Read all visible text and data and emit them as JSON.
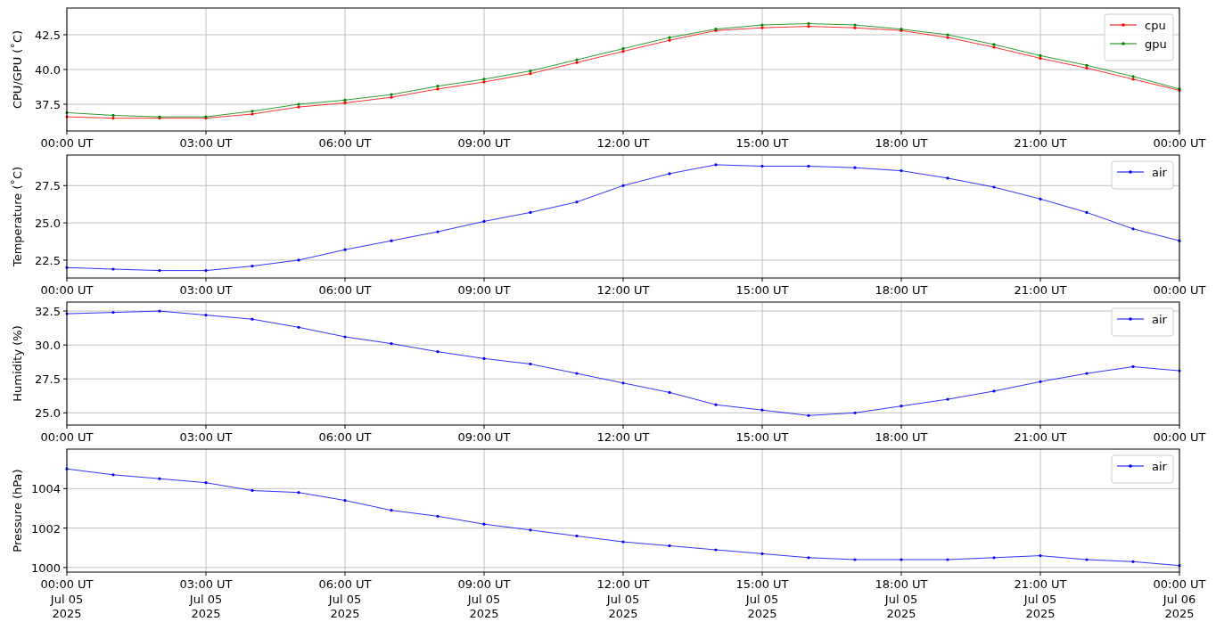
{
  "charts": [
    {
      "chart_data": {
        "type": "line",
        "grid": true,
        "legend": true,
        "ylabel": "CPU/GPU (˚C)",
        "categories": [
          "00:00 UT",
          null,
          null,
          "03:00 UT",
          null,
          null,
          "06:00 UT",
          null,
          null,
          "09:00 UT",
          null,
          null,
          "12:00 UT",
          null,
          null,
          "15:00 UT",
          null,
          null,
          "18:00 UT",
          null,
          null,
          "21:00 UT",
          null,
          null,
          "00:00 UT"
        ],
        "ylim": [
          35.58,
          44.42
        ],
        "yticks": [
          {
            "value": 37.5,
            "label": "37.5"
          },
          {
            "value": 40,
            "label": "40.0"
          },
          {
            "value": 42.5,
            "label": "42.5"
          }
        ],
        "series": [
          {
            "name": "cpu",
            "color": "#ff0000",
            "values": [
              36.6,
              36.5,
              36.5,
              36.5,
              36.8,
              37.3,
              37.6,
              38.0,
              38.6,
              39.1,
              39.7,
              40.5,
              41.3,
              42.1,
              42.8,
              43.0,
              43.1,
              43.0,
              42.8,
              42.3,
              41.6,
              40.8,
              40.1,
              39.3,
              38.5
            ]
          },
          {
            "name": "gpu",
            "color": "#008000",
            "values": [
              36.9,
              36.7,
              36.6,
              36.6,
              37.0,
              37.5,
              37.8,
              38.2,
              38.8,
              39.3,
              39.9,
              40.7,
              41.5,
              42.3,
              42.9,
              43.2,
              43.3,
              43.2,
              42.9,
              42.5,
              41.8,
              41.0,
              40.3,
              39.5,
              38.6
            ]
          }
        ]
      }
    },
    {
      "chart_data": {
        "type": "line",
        "grid": true,
        "legend": true,
        "ylabel": "Temperature (˚C)",
        "categories": [
          "00:00 UT",
          null,
          null,
          "03:00 UT",
          null,
          null,
          "06:00 UT",
          null,
          null,
          "09:00 UT",
          null,
          null,
          "12:00 UT",
          null,
          null,
          "15:00 UT",
          null,
          null,
          "18:00 UT",
          null,
          null,
          "21:00 UT",
          null,
          null,
          "00:00 UT"
        ],
        "ylim": [
          21.3,
          29.55
        ],
        "yticks": [
          {
            "value": 22.5,
            "label": "22.5"
          },
          {
            "value": 25,
            "label": "25.0"
          },
          {
            "value": 27.5,
            "label": "27.5"
          }
        ],
        "series": [
          {
            "name": "air",
            "color": "#0000ff",
            "values": [
              22.0,
              21.9,
              21.8,
              21.8,
              22.1,
              22.5,
              23.2,
              23.8,
              24.4,
              25.1,
              25.7,
              26.4,
              27.5,
              28.3,
              28.9,
              28.8,
              28.8,
              28.7,
              28.5,
              28.0,
              27.4,
              26.6,
              25.7,
              24.6,
              23.8
            ]
          }
        ]
      }
    },
    {
      "chart_data": {
        "type": "line",
        "grid": true,
        "legend": true,
        "ylabel": "Humidity (%)",
        "categories": [
          "00:00 UT",
          null,
          null,
          "03:00 UT",
          null,
          null,
          "06:00 UT",
          null,
          null,
          "09:00 UT",
          null,
          null,
          "12:00 UT",
          null,
          null,
          "15:00 UT",
          null,
          null,
          "18:00 UT",
          null,
          null,
          "21:00 UT",
          null,
          null,
          "00:00 UT"
        ],
        "ylim": [
          24.1,
          33.16
        ],
        "yticks": [
          {
            "value": 25,
            "label": "25.0"
          },
          {
            "value": 27.5,
            "label": "27.5"
          },
          {
            "value": 30,
            "label": "30.0"
          },
          {
            "value": 32.5,
            "label": "32.5"
          }
        ],
        "series": [
          {
            "name": "air",
            "color": "#0000ff",
            "values": [
              32.3,
              32.4,
              32.5,
              32.2,
              31.9,
              31.3,
              30.6,
              30.1,
              29.5,
              29.0,
              28.6,
              27.9,
              27.2,
              26.5,
              25.6,
              25.2,
              24.8,
              25.0,
              25.5,
              26.0,
              26.6,
              27.3,
              27.9,
              28.4,
              28.1
            ]
          }
        ]
      }
    },
    {
      "chart_data": {
        "type": "line",
        "grid": true,
        "legend": true,
        "ylabel": "Pressure (hPa)",
        "categories": [
          "00:00 UT\nJul 05\n2025",
          null,
          null,
          "03:00 UT\nJul 05\n2025",
          null,
          null,
          "06:00 UT\nJul 05\n2025",
          null,
          null,
          "09:00 UT\nJul 05\n2025",
          null,
          null,
          "12:00 UT\nJul 05\n2025",
          null,
          null,
          "15:00 UT\nJul 05\n2025",
          null,
          null,
          "18:00 UT\nJul 05\n2025",
          null,
          null,
          "21:00 UT\nJul 05\n2025",
          null,
          null,
          "00:00 UT\nJul 06\n2025"
        ],
        "ylim": [
          999.77,
          1006.0
        ],
        "yticks": [
          {
            "value": 1000,
            "label": "1000"
          },
          {
            "value": 1002,
            "label": "1002"
          },
          {
            "value": 1004,
            "label": "1004"
          }
        ],
        "series": [
          {
            "name": "air",
            "color": "#0000ff",
            "values": [
              1005.0,
              1004.7,
              1004.5,
              1004.3,
              1003.9,
              1003.8,
              1003.4,
              1002.9,
              1002.6,
              1002.2,
              1001.9,
              1001.6,
              1001.3,
              1001.1,
              1000.9,
              1000.7,
              1000.5,
              1000.4,
              1000.4,
              1000.4,
              1000.5,
              1000.6,
              1000.4,
              1000.3,
              1000.1
            ]
          }
        ]
      }
    }
  ]
}
